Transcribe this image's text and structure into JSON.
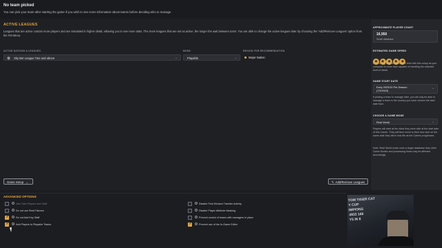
{
  "header": {
    "title": "No team picked",
    "subtitle": "You can pick your team after starting the game if you wish to see more information about teams before deciding who to manage."
  },
  "active_leagues": {
    "title": "ACTIVE LEAGUES",
    "description": "Leagues that are active contain more players and are simulated in higher detail, allowing you to see more stats. The more leagues that are set as active, the longer the wait between turns. You are able to change the active leagues later by choosing the 'Add/Remove Leagues' option from the FM Menu.",
    "col_nations": "ACTIVE NATIONS & LEAGUES",
    "col_mode": "MODE",
    "col_region": "REGION FOR RECOMMENDATION",
    "league_value": "Sky Bet League Two and above",
    "mode_value": "Playable",
    "region_value": "Major Nation"
  },
  "buttons": {
    "game_setup": "Game Setup",
    "add_remove": "Add/Remove Leagues"
  },
  "advanced": {
    "title": "ADVANCED OPTIONS",
    "left": [
      {
        "label": "Use Fake Players and Staff",
        "checked": false,
        "dim": true
      },
      {
        "label": "Do not use Real Fixtures",
        "checked": false,
        "dim": false
      },
      {
        "label": "Do not Add Key Staff",
        "checked": true,
        "dim": false
      },
      {
        "label": "Add Players to Playable Teams",
        "checked": true,
        "dim": false
      }
    ],
    "right": [
      {
        "label": "Disable First Window Transfer Activity",
        "checked": false,
        "dim": false
      },
      {
        "label": "Disable Player Attribute Masking",
        "checked": false,
        "dim": false
      },
      {
        "label": "Prevent control of teams with managers in place",
        "checked": false,
        "dim": false
      },
      {
        "label": "Prevent use of the In-Game Editor",
        "checked": true,
        "dim": false
      }
    ]
  },
  "sidebar": {
    "player_count_title": "APPROXIMATE PLAYER COUNT",
    "player_count": "16,950",
    "player_count_sub": "Small database",
    "speed_title": "ESTIMATED GAME SPEED",
    "speed_stars": 5,
    "speed_text": "Processing leagues should be brief with this setup as your computer is more than capable of handling the selected level of detail.",
    "start_title": "GAME START DATE",
    "start_value_line1": "Early 2023/24 Pre-Season",
    "start_value_line2": "(7/3/2023)",
    "start_text": "If picking a team to manage later, you will only be able to manage a team in the country you have chosen the start date from.",
    "mode_title": "CHOOSE A GAME MODE",
    "mode_value": "Real World",
    "mode_text1": "Players will start at the clubs they were with at the start date of this Career. They will then move to their new club on the same date they did in real life as the Career progresses.",
    "mode_text2": "Note: Real World mode uses a larger database than other Game Modes and processing times may be affected accordingly."
  },
  "webcam": {
    "lines": [
      "TOM TIGER CAT",
      "Y CUP",
      "IMPIONS",
      "4933 168",
      "Y5 IN 8"
    ]
  },
  "colors": {
    "accent": "#e2a53a",
    "background": "#1c1d21",
    "panel": "#24262a"
  }
}
